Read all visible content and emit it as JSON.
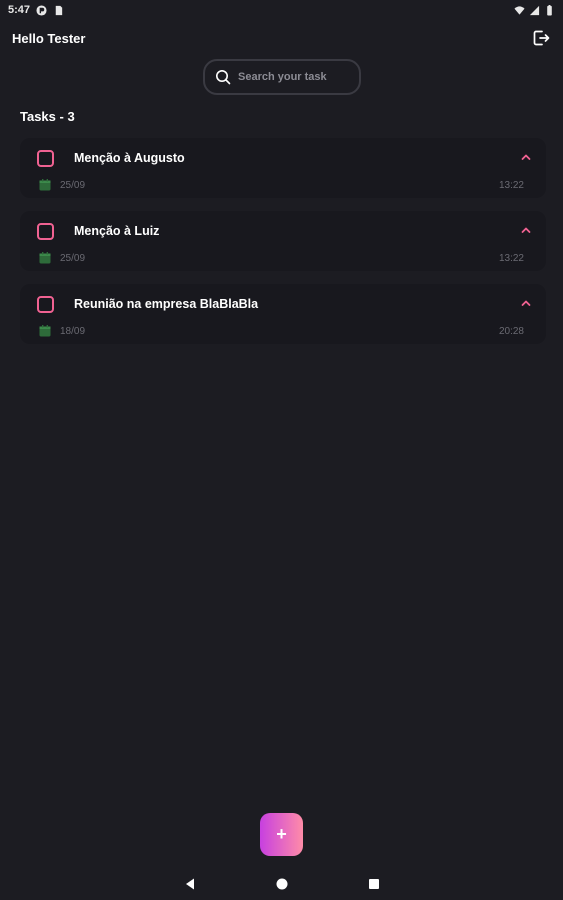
{
  "status_bar": {
    "time": "5:47"
  },
  "header": {
    "greeting": "Hello Tester"
  },
  "search": {
    "placeholder": "Search your task"
  },
  "tasks": {
    "heading": "Tasks - 3",
    "items": [
      {
        "title": "Menção à Augusto",
        "date": "25/09",
        "time": "13:22"
      },
      {
        "title": "Menção à Luiz",
        "date": "25/09",
        "time": "13:22"
      },
      {
        "title": "Reunião na empresa BlaBlaBla",
        "date": "18/09",
        "time": "20:28"
      }
    ]
  },
  "fab": {
    "label": "+"
  },
  "colors": {
    "background": "#1c1c22",
    "card": "#18181e",
    "accent": "#f06292",
    "calendar": "#2e6b3a"
  },
  "icons": {
    "logout": "logout-icon",
    "search": "search-icon",
    "checkbox": "checkbox-icon",
    "chevron": "chevron-up-icon",
    "calendar": "calendar-icon"
  }
}
